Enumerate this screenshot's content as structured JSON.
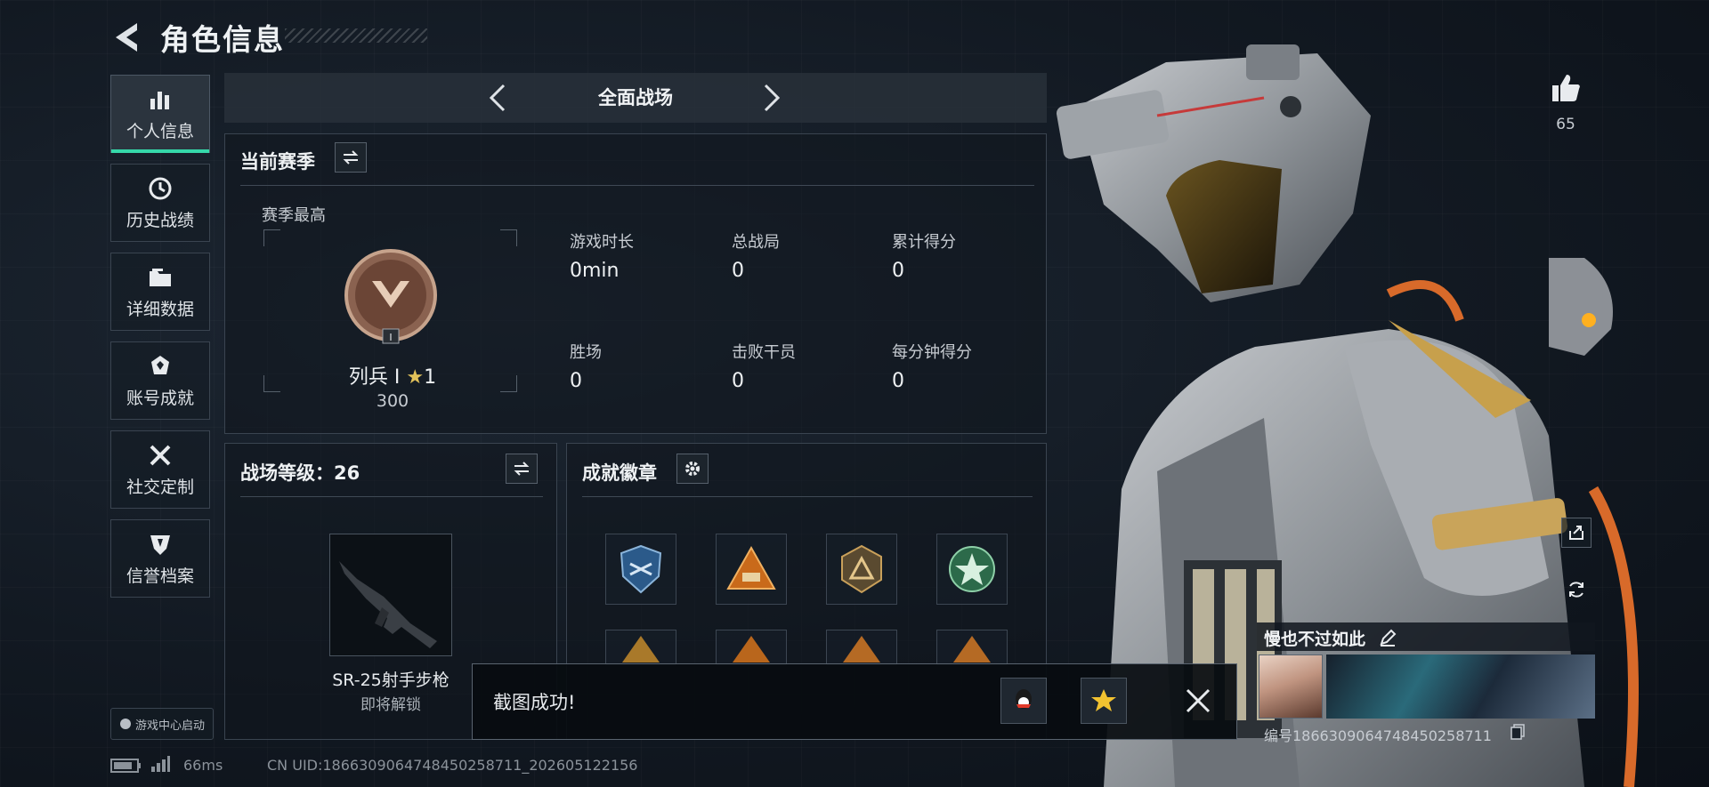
{
  "header": {
    "title": "角色信息"
  },
  "nav": [
    {
      "label": "个人信息",
      "icon": "bar-chart-icon",
      "active": true
    },
    {
      "label": "历史战绩",
      "icon": "clock-icon",
      "active": false
    },
    {
      "label": "详细数据",
      "icon": "folder-icon",
      "active": false
    },
    {
      "label": "账号成就",
      "icon": "achievement-icon",
      "active": false
    },
    {
      "label": "社交定制",
      "icon": "tools-icon",
      "active": false
    },
    {
      "label": "信誉档案",
      "icon": "credit-shield-icon",
      "active": false
    }
  ],
  "gamecenter_label": "游戏中心启动",
  "mode": {
    "title": "全面战场"
  },
  "season": {
    "title": "当前赛季",
    "best_label": "赛季最高",
    "rank_name": "列兵 I",
    "rank_stars": "1",
    "rank_points": "300",
    "rank_tier_mark": "I",
    "stats": [
      {
        "label": "游戏时长",
        "value": "0min"
      },
      {
        "label": "总战局",
        "value": "0"
      },
      {
        "label": "累计得分",
        "value": "0"
      },
      {
        "label": "胜场",
        "value": "0"
      },
      {
        "label": "击败干员",
        "value": "0"
      },
      {
        "label": "每分钟得分",
        "value": "0"
      }
    ]
  },
  "battlefield_level": {
    "title": "战场等级：26",
    "weapon_name": "SR-25射手步枪",
    "weapon_status": "即将解锁"
  },
  "achievements": {
    "title": "成就徽章",
    "badges": [
      {
        "icon": "shield-badge-icon",
        "color": "#3f7fb8"
      },
      {
        "icon": "triangle-badge-icon",
        "color": "#d2781e"
      },
      {
        "icon": "hex-badge-icon",
        "color": "#b98a4a"
      },
      {
        "icon": "star-badge-icon",
        "color": "#3a9a6a"
      },
      {
        "icon": "triangle-badge-icon",
        "color": "#c9a23a"
      },
      {
        "icon": "triangle-badge-icon",
        "color": "#d2781e"
      },
      {
        "icon": "triangle-badge-icon",
        "color": "#c9782a"
      },
      {
        "icon": "triangle-badge-icon",
        "color": "#c9782a"
      }
    ]
  },
  "toast": {
    "text": "截图成功!"
  },
  "likes": {
    "count": "65"
  },
  "player": {
    "name": "慢也不过如此",
    "id_label": "编号1866309064748450258711"
  },
  "footer": {
    "ping": "66ms",
    "uid": "CN UID:1866309064748450258711_202605122156"
  },
  "colors": {
    "accent": "#35d7a9",
    "rank_star": "#e2c25a"
  }
}
